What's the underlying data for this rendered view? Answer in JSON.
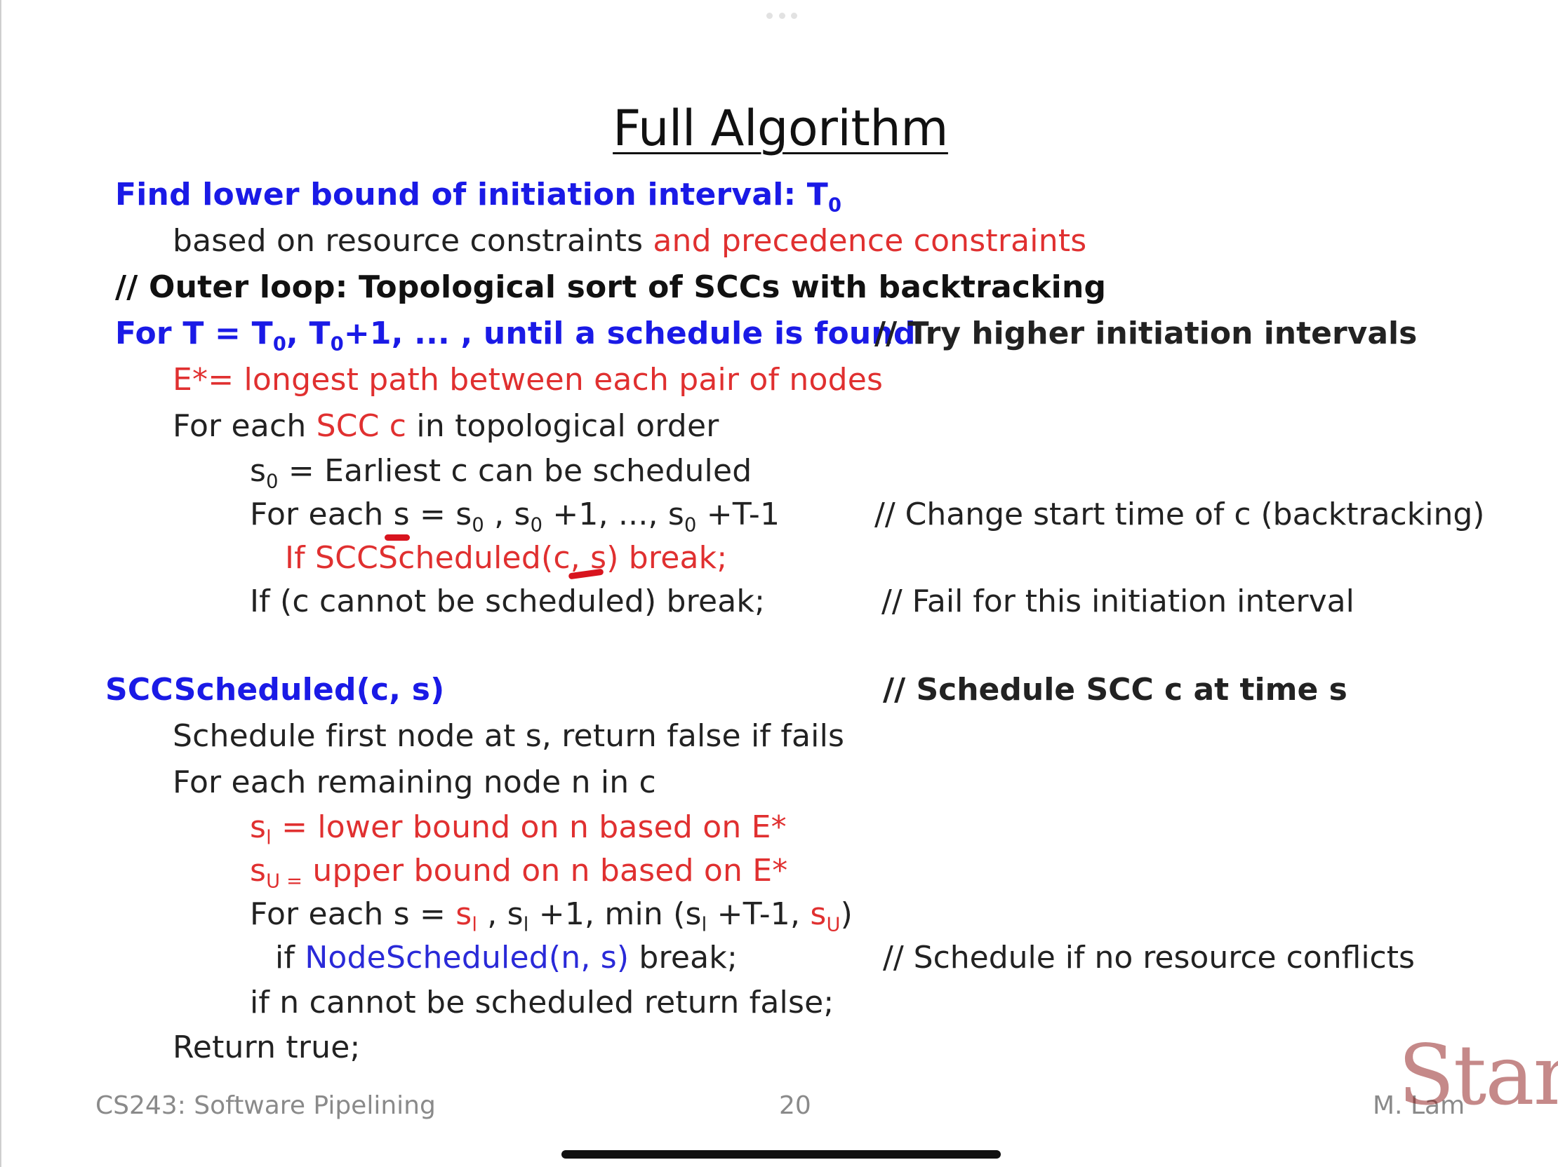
{
  "title": "Full Algorithm",
  "lines": {
    "l1_a": "Find lower bound of initiation interval: T",
    "l1_sub": "0",
    "l2_a": "based on resource constraints ",
    "l2_b": "and precedence constraints",
    "l3": "// Outer loop: Topological sort of SCCs with backtracking",
    "l4_a": "For T = T",
    "l4_s1": "0",
    "l4_b": ", T",
    "l4_s2": "0",
    "l4_c": "+1, ... , until a schedule is found",
    "l4_comment": "// Try higher initiation intervals",
    "l5": "E*= longest path between each pair of nodes",
    "l6_a": "For each ",
    "l6_b": "SCC c",
    "l6_c": " in topological order",
    "l7_a": "s",
    "l7_sub": "0",
    "l7_b": " = Earliest c can be scheduled",
    "l8_a": "For each s = s",
    "l8_s1": "0",
    "l8_b": " , s",
    "l8_s2": "0",
    "l8_c": " +1, ..., s",
    "l8_s3": "0",
    "l8_d": " +T-1",
    "l8_comment": "// Change start time of c (backtracking)",
    "l9": "If SCCScheduled(c, s) break;",
    "l10": "If (c cannot be scheduled) break;",
    "l10_comment": "// Fail for this initiation interval",
    "l11": "SCCScheduled(c, s)",
    "l11_comment": "// Schedule SCC c at time s",
    "l12": "Schedule first node at s, return false if fails",
    "l13": "For each remaining node n in c",
    "l14_a": "s",
    "l14_sub": "l",
    "l14_b": " = lower bound on n based on E*",
    "l15_a": "s",
    "l15_sub": "U =",
    "l15_b": " upper bound on n based on E*",
    "l16_a": "For each s = ",
    "l16_b": "s",
    "l16_bs": "l",
    "l16_c": " , s",
    "l16_cs": "l",
    "l16_d": " +1, min (s",
    "l16_ds": "l",
    "l16_e": " +T-1, ",
    "l16_f": "s",
    "l16_fs": "U",
    "l16_g": ")",
    "l17_a": "if ",
    "l17_b": "NodeScheduled(n, s)",
    "l17_c": " break;",
    "l17_comment": "// Schedule if no resource conflicts",
    "l18": "if n cannot be scheduled return false;",
    "l19": "Return true;"
  },
  "footer": {
    "course": "CS243: Software Pipelining",
    "page": "20",
    "author": "M. Lam",
    "logo": "Stan"
  },
  "colors": {
    "heading_blue": "#1a1ae6",
    "red": "#e03030",
    "annotation_red": "#d8141e",
    "logo_cardinal": "#8c1515"
  }
}
